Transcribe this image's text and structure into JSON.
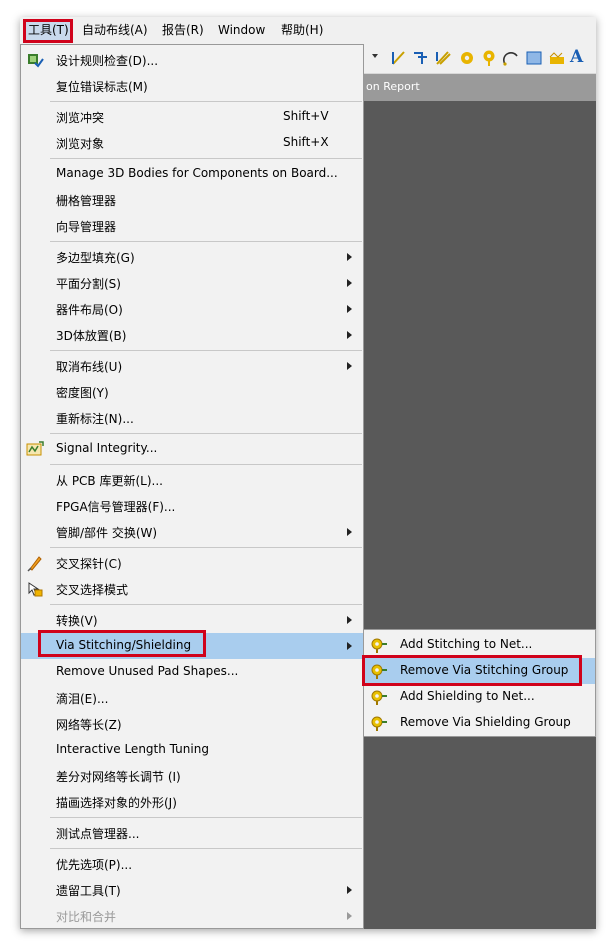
{
  "menubar": {
    "items": [
      "工具(T)",
      "自动布线(A)",
      "报告(R)",
      "Window",
      "帮助(H)"
    ]
  },
  "panel": {
    "title": "on Report"
  },
  "menu": {
    "items": [
      {
        "label": "设计规则检查(D)...",
        "icon": "drc-check-icon"
      },
      {
        "label": "复位错误标志(M)"
      },
      {
        "label": "浏览冲突",
        "shortcut": "Shift+V"
      },
      {
        "label": "浏览对象",
        "shortcut": "Shift+X"
      },
      {
        "label": "Manage 3D Bodies for Components on Board..."
      },
      {
        "label": "栅格管理器"
      },
      {
        "label": "向导管理器"
      },
      {
        "label": "多边型填充(G)",
        "submenu": true
      },
      {
        "label": "平面分割(S)",
        "submenu": true
      },
      {
        "label": "器件布局(O)",
        "submenu": true
      },
      {
        "label": "3D体放置(B)",
        "submenu": true
      },
      {
        "label": "取消布线(U)",
        "submenu": true
      },
      {
        "label": "密度图(Y)"
      },
      {
        "label": "重新标注(N)..."
      },
      {
        "label": "Signal Integrity...",
        "icon": "signal-integrity-icon"
      },
      {
        "label": "从 PCB 库更新(L)..."
      },
      {
        "label": "FPGA信号管理器(F)..."
      },
      {
        "label": "管脚/部件 交换(W)",
        "submenu": true
      },
      {
        "label": "交叉探针(C)",
        "icon": "cross-probe-icon"
      },
      {
        "label": "交叉选择模式",
        "icon": "cross-select-icon"
      },
      {
        "label": "转换(V)",
        "submenu": true
      },
      {
        "label": "Via Stitching/Shielding",
        "submenu": true,
        "highlighted": true
      },
      {
        "label": "Remove Unused Pad Shapes..."
      },
      {
        "label": "滴泪(E)..."
      },
      {
        "label": "网络等长(Z)"
      },
      {
        "label": "Interactive Length Tuning"
      },
      {
        "label": "差分对网络等长调节 (I)"
      },
      {
        "label": "描画选择对象的外形(J)"
      },
      {
        "label": "测试点管理器..."
      },
      {
        "label": "优先选项(P)..."
      },
      {
        "label": "遗留工具(T)",
        "submenu": true
      },
      {
        "label": "对比和合并",
        "submenu": true,
        "disabled": true
      }
    ]
  },
  "submenu": {
    "items": [
      {
        "label": "Add Stitching to Net..."
      },
      {
        "label": "Remove Via Stitching Group",
        "highlighted": true
      },
      {
        "label": "Add Shielding to Net..."
      },
      {
        "label": "Remove Via Shielding Group"
      }
    ]
  }
}
